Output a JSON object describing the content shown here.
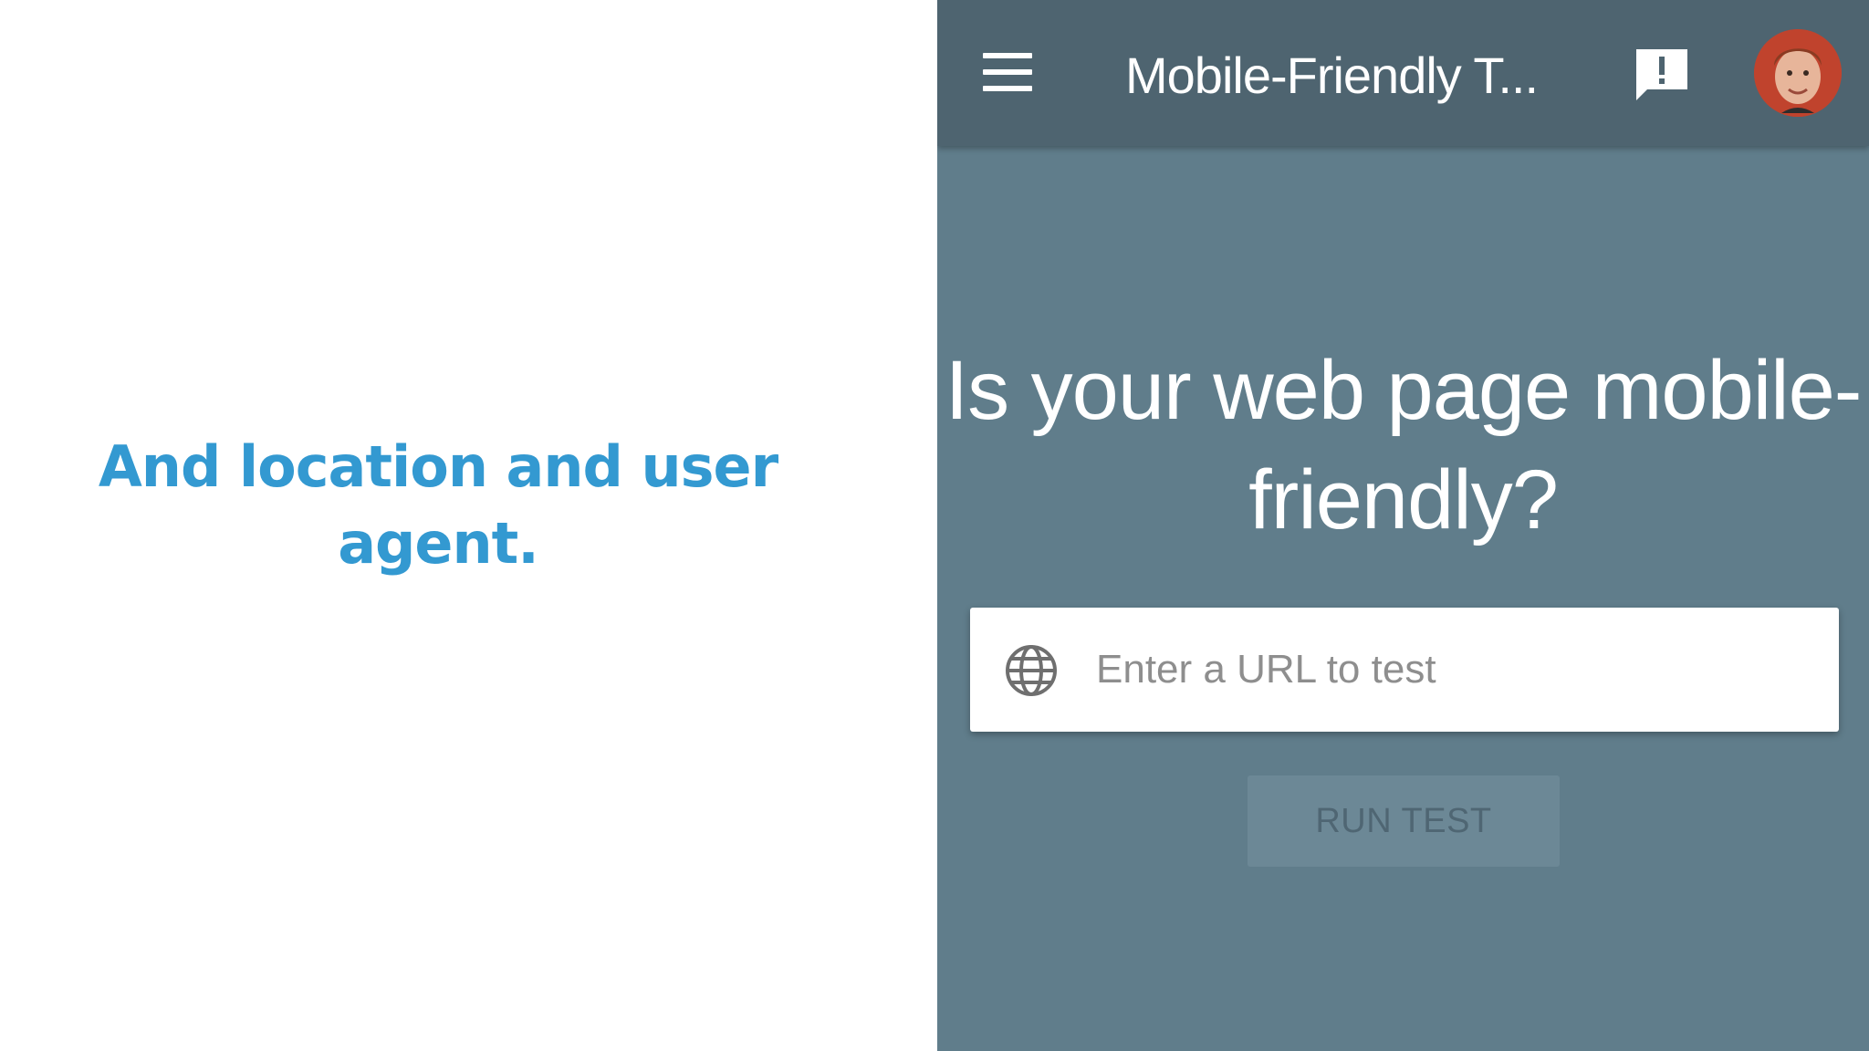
{
  "caption": {
    "text": "And location and user agent."
  },
  "appbar": {
    "menu_icon": "hamburger-menu-icon",
    "title": "Mobile-Friendly T...",
    "feedback_icon": "feedback-icon",
    "avatar": "user-avatar"
  },
  "main": {
    "headline": "Is your web page mobile-friendly?",
    "url_input": {
      "icon": "globe-icon",
      "placeholder": "Enter a URL to test",
      "value": ""
    },
    "run_button_label": "RUN TEST"
  },
  "colors": {
    "caption": "#3399d1",
    "appbar_background": "#4e6470",
    "page_background": "#607d8b",
    "input_background": "#ffffff",
    "button_background": "#6c8896",
    "button_text": "#4f6673"
  }
}
